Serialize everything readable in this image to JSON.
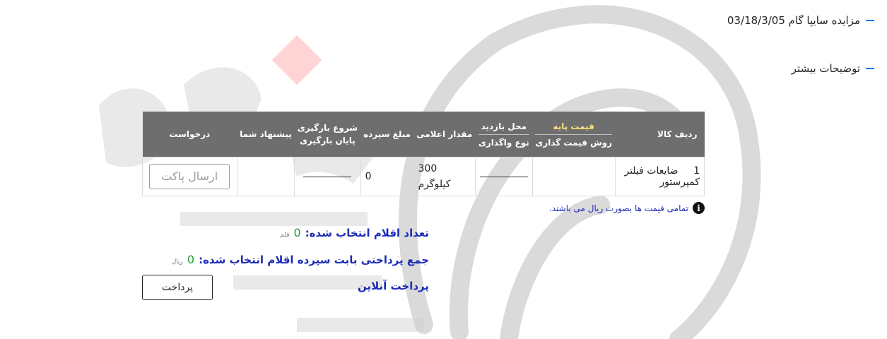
{
  "auction_link": "مزایده سایپا گام 03/18/3/05",
  "more_link": "توضیحات بیشتر",
  "table": {
    "headers": {
      "row_item": "ردیف کالا",
      "base_price": "قیمت پایه",
      "pricing_method": "روش قیمت گذاری",
      "visit_place": "محل بازدید",
      "transfer_type": "نوع واگذاری",
      "announced_qty": "مقدار اعلامی",
      "deposit": "مبلغ سپرده",
      "load_start": "شروع بارگیری",
      "load_end": "پایان بارگیری",
      "your_offer": "پیشنهاد شما",
      "request": "درخواست"
    },
    "rows": [
      {
        "row": "1",
        "item": "ضایعات فیلتر کمپرستور",
        "qty": "300",
        "unit": "کیلوگرم",
        "deposit": "0",
        "send_label": "ارسال پاکت"
      }
    ]
  },
  "note": "تمامی قیمت ها بصورت ریال می باشند.",
  "summary": {
    "count_label": "تعداد اقلام انتخاب شده:",
    "count_value": "0",
    "count_unit": "قلم",
    "pay_label": "جمع پرداختی بابت سپرده اقلام انتخاب شده:",
    "pay_value": "0",
    "pay_unit": "ریال",
    "online_label": "پرداخت آنلاین",
    "pay_button": "پرداخت"
  },
  "colors": {
    "header_bg": "#6e6e6e",
    "accent_blue": "#1d2db8",
    "value_green": "#1f9d35"
  }
}
